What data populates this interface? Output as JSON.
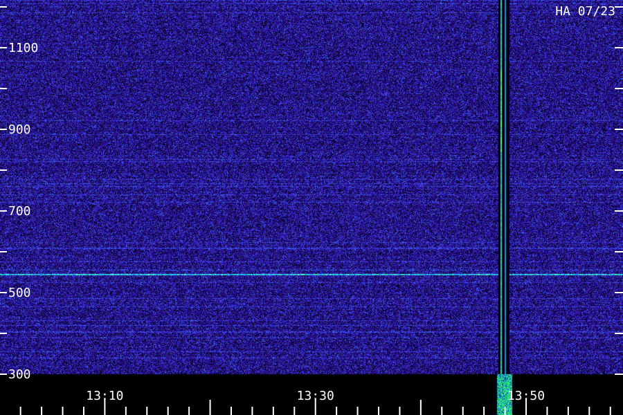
{
  "chart_data": {
    "type": "heatmap",
    "title": "HA 07/23",
    "y_ticks": [
      {
        "value": 300,
        "label": "300"
      },
      {
        "value": 400,
        "label": ""
      },
      {
        "value": 500,
        "label": "500"
      },
      {
        "value": 600,
        "label": ""
      },
      {
        "value": 700,
        "label": "700"
      },
      {
        "value": 800,
        "label": ""
      },
      {
        "value": 900,
        "label": "900"
      },
      {
        "value": 1000,
        "label": ""
      },
      {
        "value": 1100,
        "label": "1100"
      },
      {
        "value": 1200,
        "label": ""
      }
    ],
    "ylim": [
      300,
      1150
    ],
    "x_ticks": [
      "13:10",
      "13:30",
      "13:50"
    ],
    "x_tick_minutes": [
      10,
      30,
      50
    ],
    "xlim_minutes": [
      0.05,
      59.2
    ],
    "x_minor_step_minutes": 2,
    "features": [
      {
        "kind": "continuous-line",
        "y": 546
      },
      {
        "kind": "burst",
        "x_minutes": 47.5
      }
    ],
    "colormap": [
      "#000000",
      "#1a0a6e",
      "#3320c8",
      "#2a6cf0",
      "#20e0e0",
      "#30ff60"
    ]
  }
}
